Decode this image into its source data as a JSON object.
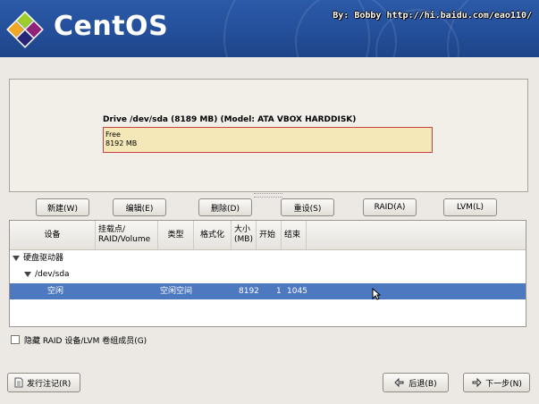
{
  "header": {
    "brand": "CentOS",
    "watermark": "By: Bobby http://hi.baidu.com/eao110/"
  },
  "drive": {
    "title": "Drive /dev/sda (8189 MB) (Model: ATA VBOX HARDDISK)",
    "segment_label": "Free",
    "segment_size": "8192 MB"
  },
  "actions": {
    "new": "新建(W)",
    "edit": "编辑(E)",
    "delete": "删除(D)",
    "reset": "重设(S)",
    "raid": "RAID(A)",
    "lvm": "LVM(L)"
  },
  "table": {
    "columns": [
      "设备",
      "挂载点/\nRAID/Volume",
      "类型",
      "格式化",
      "大小\n(MB)",
      "开始",
      "结束"
    ],
    "tree": {
      "group_label": "硬盘驱动器",
      "disk_label": "/dev/sda",
      "selected_row": {
        "device": "空闲",
        "type": "空闲空间",
        "size": "8192",
        "start": "1",
        "end": "1045"
      }
    }
  },
  "options": {
    "hide_raid_lvm_label": "隐藏 RAID 设备/LVM 卷组成员(G)"
  },
  "footer": {
    "release_notes": "发行注记(R)",
    "back": "后退(B)",
    "next": "下一步(N)"
  }
}
